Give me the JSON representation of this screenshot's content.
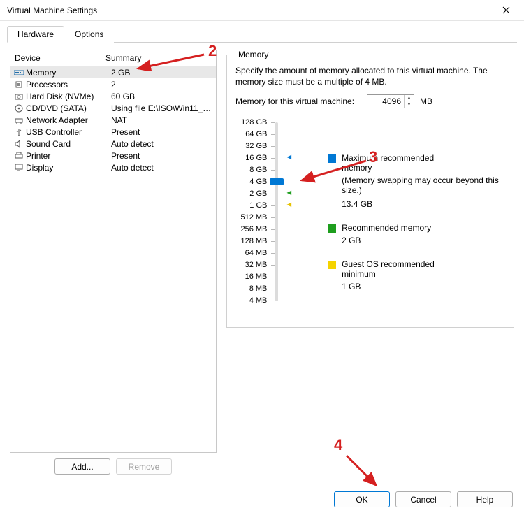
{
  "window": {
    "title": "Virtual Machine Settings"
  },
  "tabs": {
    "hardware": "Hardware",
    "options": "Options"
  },
  "list": {
    "header_device": "Device",
    "header_summary": "Summary",
    "rows": [
      {
        "icon": "memory",
        "device": "Memory",
        "summary": "2 GB",
        "selected": true
      },
      {
        "icon": "cpu",
        "device": "Processors",
        "summary": "2"
      },
      {
        "icon": "disk",
        "device": "Hard Disk (NVMe)",
        "summary": "60 GB"
      },
      {
        "icon": "cd",
        "device": "CD/DVD (SATA)",
        "summary": "Using file E:\\ISO\\Win11_Chi..."
      },
      {
        "icon": "net",
        "device": "Network Adapter",
        "summary": "NAT"
      },
      {
        "icon": "usb",
        "device": "USB Controller",
        "summary": "Present"
      },
      {
        "icon": "sound",
        "device": "Sound Card",
        "summary": "Auto detect"
      },
      {
        "icon": "printer",
        "device": "Printer",
        "summary": "Present"
      },
      {
        "icon": "display",
        "device": "Display",
        "summary": "Auto detect"
      }
    ]
  },
  "left_buttons": {
    "add": "Add...",
    "remove": "Remove"
  },
  "memory": {
    "legend": "Memory",
    "desc": "Specify the amount of memory allocated to this virtual machine. The memory size must be a multiple of 4 MB.",
    "input_label": "Memory for this virtual machine:",
    "value": "4096",
    "unit": "MB",
    "ticks": [
      "128 GB",
      "64 GB",
      "32 GB",
      "16 GB",
      "8 GB",
      "4 GB",
      "2 GB",
      "1 GB",
      "512 MB",
      "256 MB",
      "128 MB",
      "64 MB",
      "32 MB",
      "16 MB",
      "8 MB",
      "4 MB"
    ],
    "legend_items": {
      "max_label": "Maximum recommended memory",
      "max_note": "(Memory swapping may occur beyond this size.)",
      "max_value": "13.4 GB",
      "rec_label": "Recommended memory",
      "rec_value": "2 GB",
      "min_label": "Guest OS recommended minimum",
      "min_value": "1 GB"
    }
  },
  "bottom": {
    "ok": "OK",
    "cancel": "Cancel",
    "help": "Help"
  },
  "annotations": {
    "a2": "2",
    "a3": "3",
    "a4": "4"
  }
}
